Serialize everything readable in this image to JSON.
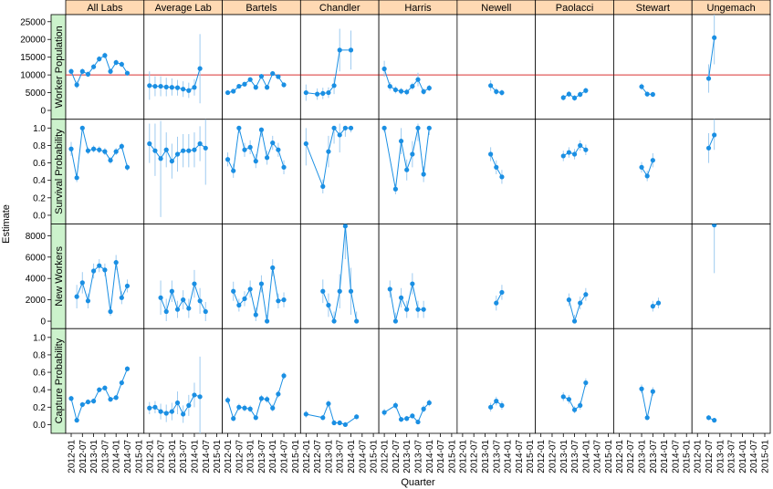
{
  "chart_data": {
    "type": "scatter",
    "xlabel": "Quarter",
    "ylabel": "Estimate",
    "x_ticks": [
      "2012-01",
      "2012-07",
      "2013-01",
      "2013-07",
      "2014-01",
      "2014-07",
      "2015-01"
    ],
    "columns": [
      "All Labs",
      "Average Lab",
      "Bartels",
      "Chandler",
      "Harris",
      "Newell",
      "Paolacci",
      "Stewart",
      "Ungemach"
    ],
    "colors": {
      "point": "#1a8fe3",
      "errorbar": "#9ecbf0",
      "reference": "#d93030",
      "strip_col": "#ffd9b3",
      "strip_row": "#ccf2cc"
    },
    "rows": [
      {
        "name": "Worker Population",
        "ylim": [
          -2500,
          27000
        ],
        "yticks": [
          0,
          5000,
          10000,
          15000,
          20000,
          25000
        ],
        "reference_line": 10000,
        "panels": [
          {
            "x": [
              0,
              1,
              2,
              3,
              4,
              5,
              6,
              7,
              8
            ],
            "y": [
              11000,
              7000,
              10500,
              10200,
              12500,
              14500,
              15500,
              11000,
              13000,
              10800
            ],
            "lo": [
              10300,
              5800,
              9700,
              9400,
              11700,
              13600,
              14600,
              10200,
              12100,
              10000
            ],
            "hi": [
              11700,
              8200,
              11300,
              11000,
              13300,
              15400,
              16400,
              11800,
              13900,
              11600
            ]
          },
          {
            "x": [
              0,
              1,
              2,
              3,
              4,
              5,
              6,
              7,
              8,
              9
            ],
            "y": [
              7000,
              6800,
              6900,
              6600,
              6700,
              6500,
              6200,
              5800,
              6500,
              11800
            ],
            "lo": [
              3000,
              3500,
              3500,
              3800,
              4000,
              3800,
              4200,
              3500,
              4000,
              2500
            ],
            "hi": [
              11000,
              10000,
              10000,
              9500,
              9500,
              9000,
              8500,
              8500,
              9500,
              21000
            ]
          },
          {
            "x": [
              0,
              1,
              2,
              3,
              4,
              5,
              6,
              7,
              8,
              9
            ],
            "y": [
              5000,
              5500,
              6800,
              7200,
              8500,
              6500,
              9500,
              6500,
              10500,
              9500,
              7500
            ],
            "lo": [
              4500,
              5000,
              6200,
              6600,
              7800,
              5800,
              8800,
              5800,
              9800,
              8800,
              6800
            ],
            "hi": [
              5500,
              6000,
              7400,
              7800,
              9200,
              7200,
              10200,
              7200,
              11200,
              10200,
              8200
            ]
          },
          {
            "x": [
              0,
              2,
              3,
              4,
              5,
              6,
              7,
              8
            ],
            "y": [
              5200,
              4800,
              5000,
              5000,
              7000,
              17000,
              17000
            ],
            "lo": [
              2800,
              3000,
              3500,
              3200,
              4800,
              11000,
              12000
            ],
            "hi": [
              7600,
              6600,
              6500,
              6800,
              9200,
              23000,
              22000
            ]
          }
        ]
      }
    ]
  }
}
